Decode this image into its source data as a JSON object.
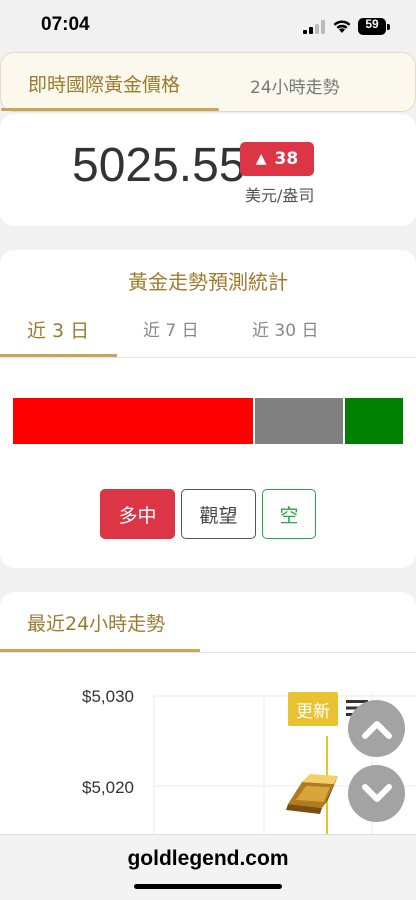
{
  "status": {
    "time": "07:04",
    "battery": "59"
  },
  "price_tabs": {
    "active": "即時國際黃金價格",
    "other": "24小時走勢"
  },
  "price": {
    "value": "5025.55",
    "change": "38",
    "change_arrow": "▲",
    "unit": "美元/盎司",
    "change_color": "#dc3545"
  },
  "forecast": {
    "title": "黃金走勢預測統計",
    "periods": [
      "近 3 日",
      "近 7 日",
      "近 30 日"
    ],
    "active_period": 0,
    "distribution": [
      {
        "label": "多中",
        "share": 0.615,
        "color": "#ff0000"
      },
      {
        "label": "觀望",
        "share": 0.23,
        "color": "#808080"
      },
      {
        "label": "空",
        "share": 0.155,
        "color": "#008000"
      }
    ],
    "buttons": {
      "bull": "多中",
      "watch": "觀望",
      "bear": "空"
    }
  },
  "trend": {
    "title": "最近24小時走勢",
    "y_ticks": [
      "$5,030",
      "$5,020"
    ],
    "update_label": "更新"
  },
  "footer": {
    "url": "goldlegend.com"
  }
}
